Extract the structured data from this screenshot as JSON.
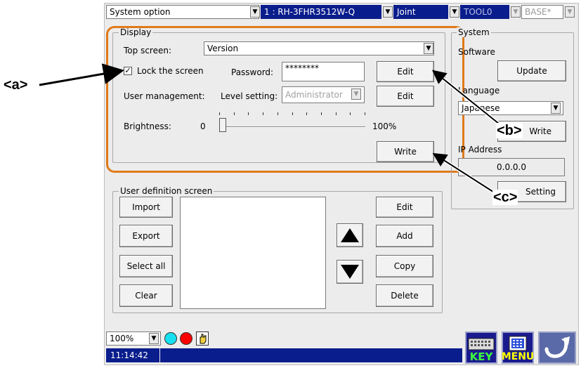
{
  "topbar": {
    "system_option": "System option",
    "robot": "1 : RH-3FHR3512W-Q",
    "jog_mode": "Joint",
    "tool": "TOOL0",
    "base": "BASE*"
  },
  "display": {
    "title": "Display",
    "top_screen_label": "Top screen:",
    "top_screen_value": "Version",
    "lock_label": "Lock the screen",
    "lock_checked": true,
    "password_label": "Password:",
    "password_value": "********",
    "edit1_label": "Edit",
    "user_mgmt_label": "User management:",
    "level_label": "Level setting:",
    "level_value": "Administrator",
    "edit2_label": "Edit",
    "brightness_label": "Brightness:",
    "brightness_min": "0",
    "brightness_max": "100%",
    "brightness_value": 0,
    "write_label": "Write"
  },
  "system": {
    "title": "System",
    "software_label": "Software",
    "update_label": "Update",
    "language_label": "Language",
    "language_value": "Japanese",
    "write_label": "Write",
    "ip_label": "IP Address",
    "ip_value": "0.0.0.0",
    "setting_label": "Setting"
  },
  "user_def": {
    "title": "User definition screen",
    "import_label": "Import",
    "export_label": "Export",
    "select_all_label": "Select all",
    "clear_label": "Clear",
    "edit_label": "Edit",
    "add_label": "Add",
    "copy_label": "Copy",
    "delete_label": "Delete"
  },
  "footer": {
    "zoom": "100%",
    "time": "11:14:42",
    "key_label": "KEY",
    "menu_label": "MENU"
  },
  "callouts": {
    "a": "<a>",
    "b": "<b>",
    "c": "<c>"
  },
  "colors": {
    "highlight": "#e07a1a",
    "title_bar": "#0a1d8c",
    "status_cyan": "#16e0ef",
    "status_red": "#ff0000",
    "key_green": "#3cff3c",
    "menu_yellow": "#ffff00"
  }
}
